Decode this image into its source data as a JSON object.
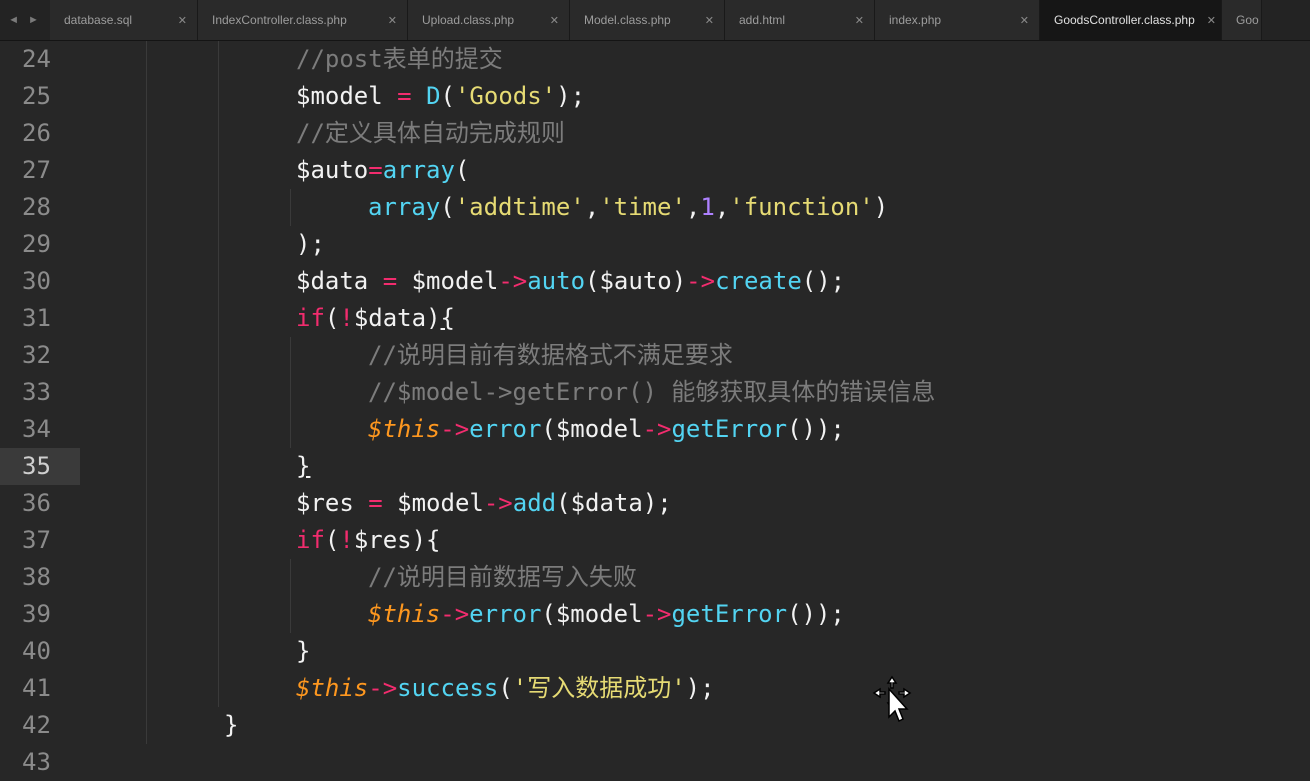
{
  "tabs": [
    {
      "label": "database.sql",
      "active": false
    },
    {
      "label": "IndexController.class.php",
      "active": false
    },
    {
      "label": "Upload.class.php",
      "active": false
    },
    {
      "label": "Model.class.php",
      "active": false
    },
    {
      "label": "add.html",
      "active": false
    },
    {
      "label": "index.php",
      "active": false
    },
    {
      "label": "GoodsController.class.php",
      "active": true
    },
    {
      "label": "Goo",
      "active": false
    }
  ],
  "editor": {
    "current_line": 35,
    "lines": [
      {
        "n": 24,
        "indent": 3,
        "tokens": [
          {
            "t": "//post表单的提交",
            "c": "c"
          }
        ]
      },
      {
        "n": 25,
        "indent": 3,
        "tokens": [
          {
            "t": "$model",
            "c": "v"
          },
          {
            "t": " = ",
            "c": "op"
          },
          {
            "t": "D",
            "c": "f"
          },
          {
            "t": "(",
            "c": "p"
          },
          {
            "t": "'Goods'",
            "c": "s"
          },
          {
            "t": ");",
            "c": "p"
          }
        ]
      },
      {
        "n": 26,
        "indent": 3,
        "tokens": [
          {
            "t": "//定义具体自动完成规则",
            "c": "c"
          }
        ]
      },
      {
        "n": 27,
        "indent": 3,
        "tokens": [
          {
            "t": "$auto",
            "c": "v"
          },
          {
            "t": "=",
            "c": "op"
          },
          {
            "t": "array",
            "c": "f"
          },
          {
            "t": "(",
            "c": "p"
          }
        ]
      },
      {
        "n": 28,
        "indent": 4,
        "tokens": [
          {
            "t": "array",
            "c": "f"
          },
          {
            "t": "(",
            "c": "p"
          },
          {
            "t": "'addtime'",
            "c": "s"
          },
          {
            "t": ",",
            "c": "p"
          },
          {
            "t": "'time'",
            "c": "s"
          },
          {
            "t": ",",
            "c": "p"
          },
          {
            "t": "1",
            "c": "n"
          },
          {
            "t": ",",
            "c": "p"
          },
          {
            "t": "'function'",
            "c": "s"
          },
          {
            "t": ")",
            "c": "p"
          }
        ]
      },
      {
        "n": 29,
        "indent": 3,
        "tokens": [
          {
            "t": ");",
            "c": "p"
          }
        ]
      },
      {
        "n": 30,
        "indent": 3,
        "tokens": [
          {
            "t": "$data",
            "c": "v"
          },
          {
            "t": " = ",
            "c": "op"
          },
          {
            "t": "$model",
            "c": "v"
          },
          {
            "t": "->",
            "c": "op"
          },
          {
            "t": "auto",
            "c": "f"
          },
          {
            "t": "(",
            "c": "p"
          },
          {
            "t": "$auto",
            "c": "v"
          },
          {
            "t": ")",
            "c": "p"
          },
          {
            "t": "->",
            "c": "op"
          },
          {
            "t": "create",
            "c": "f"
          },
          {
            "t": "();",
            "c": "p"
          }
        ]
      },
      {
        "n": 31,
        "indent": 3,
        "tokens": [
          {
            "t": "if",
            "c": "k"
          },
          {
            "t": "(",
            "c": "p"
          },
          {
            "t": "!",
            "c": "op"
          },
          {
            "t": "$data",
            "c": "v"
          },
          {
            "t": ")",
            "c": "p"
          },
          {
            "t": "{",
            "c": "p u"
          }
        ]
      },
      {
        "n": 32,
        "indent": 4,
        "tokens": [
          {
            "t": "//说明目前有数据格式不满足要求",
            "c": "c"
          }
        ]
      },
      {
        "n": 33,
        "indent": 4,
        "tokens": [
          {
            "t": "//$model->getError() 能够获取具体的错误信息",
            "c": "c"
          }
        ]
      },
      {
        "n": 34,
        "indent": 4,
        "tokens": [
          {
            "t": "$this",
            "c": "t"
          },
          {
            "t": "->",
            "c": "op"
          },
          {
            "t": "error",
            "c": "f"
          },
          {
            "t": "(",
            "c": "p"
          },
          {
            "t": "$model",
            "c": "v"
          },
          {
            "t": "->",
            "c": "op"
          },
          {
            "t": "getError",
            "c": "f"
          },
          {
            "t": "());",
            "c": "p"
          }
        ]
      },
      {
        "n": 35,
        "indent": 3,
        "tokens": [
          {
            "t": "}",
            "c": "p u"
          }
        ]
      },
      {
        "n": 36,
        "indent": 3,
        "tokens": [
          {
            "t": "$res",
            "c": "v"
          },
          {
            "t": " = ",
            "c": "op"
          },
          {
            "t": "$model",
            "c": "v"
          },
          {
            "t": "->",
            "c": "op"
          },
          {
            "t": "add",
            "c": "f"
          },
          {
            "t": "(",
            "c": "p"
          },
          {
            "t": "$data",
            "c": "v"
          },
          {
            "t": ");",
            "c": "p"
          }
        ]
      },
      {
        "n": 37,
        "indent": 3,
        "tokens": [
          {
            "t": "if",
            "c": "k"
          },
          {
            "t": "(",
            "c": "p"
          },
          {
            "t": "!",
            "c": "op"
          },
          {
            "t": "$res",
            "c": "v"
          },
          {
            "t": "){",
            "c": "p"
          }
        ]
      },
      {
        "n": 38,
        "indent": 4,
        "tokens": [
          {
            "t": "//说明目前数据写入失败",
            "c": "c"
          }
        ]
      },
      {
        "n": 39,
        "indent": 4,
        "tokens": [
          {
            "t": "$this",
            "c": "t"
          },
          {
            "t": "->",
            "c": "op"
          },
          {
            "t": "error",
            "c": "f"
          },
          {
            "t": "(",
            "c": "p"
          },
          {
            "t": "$model",
            "c": "v"
          },
          {
            "t": "->",
            "c": "op"
          },
          {
            "t": "getError",
            "c": "f"
          },
          {
            "t": "());",
            "c": "p"
          }
        ]
      },
      {
        "n": 40,
        "indent": 3,
        "tokens": [
          {
            "t": "}",
            "c": "p"
          }
        ]
      },
      {
        "n": 41,
        "indent": 3,
        "tokens": [
          {
            "t": "$this",
            "c": "t"
          },
          {
            "t": "->",
            "c": "op"
          },
          {
            "t": "success",
            "c": "f"
          },
          {
            "t": "(",
            "c": "p"
          },
          {
            "t": "'写入数据成功'",
            "c": "s"
          },
          {
            "t": ");",
            "c": "p"
          }
        ]
      },
      {
        "n": 42,
        "indent": 2,
        "tokens": [
          {
            "t": "}",
            "c": "p"
          }
        ]
      },
      {
        "n": 43,
        "indent": 0,
        "tokens": []
      }
    ]
  },
  "icons": {
    "nav": "nav-arrows-icon",
    "tab_close": "close-icon",
    "cursor": "move-cursor-icon"
  }
}
